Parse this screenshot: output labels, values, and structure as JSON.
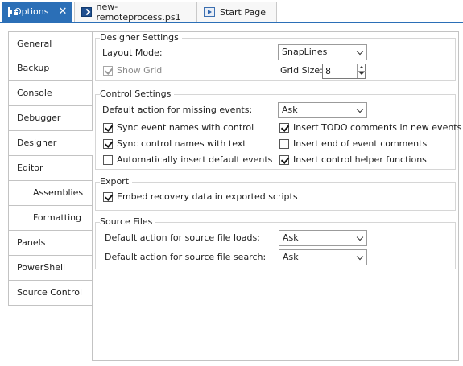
{
  "tabs": [
    {
      "label": "Options",
      "icon": "options-icon",
      "active": true
    },
    {
      "label": "new-remoteprocess.ps1",
      "icon": "powershell-file-icon",
      "active": false
    },
    {
      "label": "Start Page",
      "icon": "start-page-icon",
      "active": false
    }
  ],
  "tab_close_glyph": "✕",
  "nav": {
    "items": [
      {
        "label": "General"
      },
      {
        "label": "Backup"
      },
      {
        "label": "Console"
      },
      {
        "label": "Debugger"
      },
      {
        "label": "Designer",
        "selected": true
      },
      {
        "label": "Editor"
      },
      {
        "label": "Assemblies",
        "sub": true
      },
      {
        "label": "Formatting",
        "sub": true
      },
      {
        "label": "Panels"
      },
      {
        "label": "PowerShell"
      },
      {
        "label": "Source Control"
      }
    ]
  },
  "designer_settings": {
    "title": "Designer Settings",
    "layout_mode_label": "Layout Mode:",
    "layout_mode_value": "SnapLines",
    "show_grid_label": "Show Grid",
    "show_grid_checked": true,
    "grid_size_label": "Grid Size:",
    "grid_size_value": "8"
  },
  "control_settings": {
    "title": "Control Settings",
    "missing_events_label": "Default action for missing events:",
    "missing_events_value": "Ask",
    "sync_event_label": "Sync event names with control",
    "sync_control_label": "Sync control names with text",
    "auto_insert_label": "Automatically insert default events",
    "insert_todo_label": "Insert TODO comments in new events",
    "insert_end_label": "Insert end of event comments",
    "insert_helper_label": "Insert control helper functions"
  },
  "export": {
    "title": "Export",
    "embed_label": "Embed recovery data in exported scripts"
  },
  "source_files": {
    "title": "Source Files",
    "loads_label": "Default action for source file loads:",
    "loads_value": "Ask",
    "search_label": "Default action for source file search:",
    "search_value": "Ask"
  },
  "colors": {
    "accent": "#2b6fb7",
    "border": "#c3c3c3",
    "group_border": "#d6d6d6"
  }
}
